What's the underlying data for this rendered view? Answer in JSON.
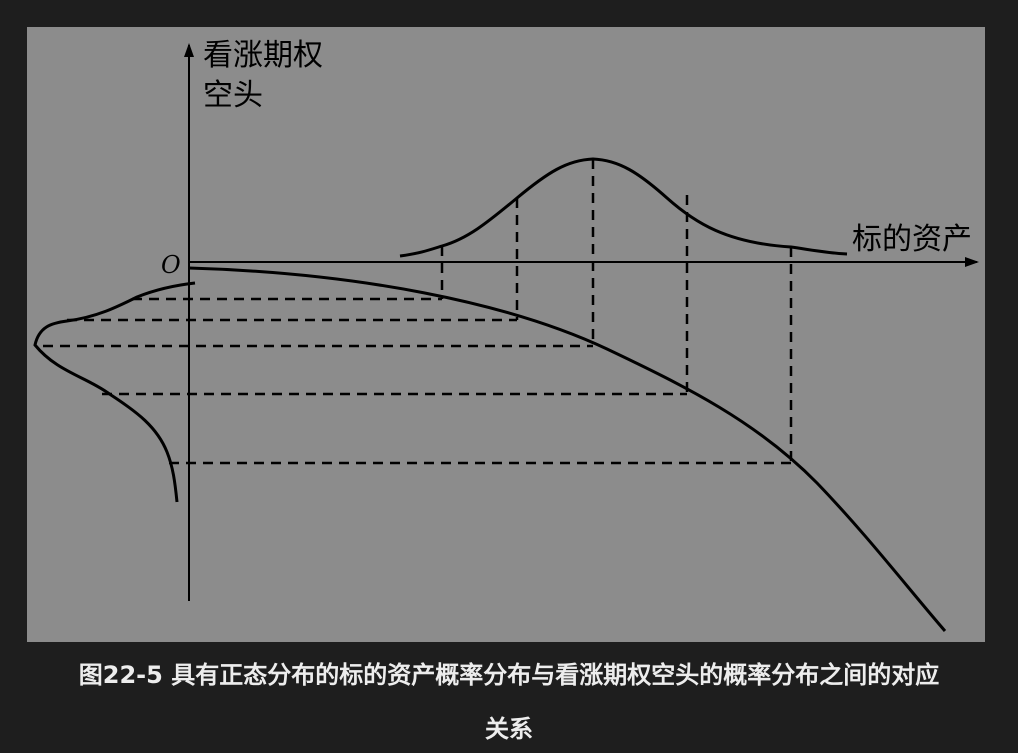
{
  "diagram": {
    "y_axis_label_line1": "看涨期权",
    "y_axis_label_line2": "空头",
    "x_axis_label": "标的资产",
    "origin_label": "O"
  },
  "caption": {
    "line1": "图22-5 具有正态分布的标的资产概率分布与看涨期权空头的概率分布之间的对应",
    "line2": "关系"
  },
  "colors": {
    "background": "#1e1e1e",
    "panel": "#8c8c8c",
    "ink": "#000000",
    "caption_text": "#ededed"
  }
}
